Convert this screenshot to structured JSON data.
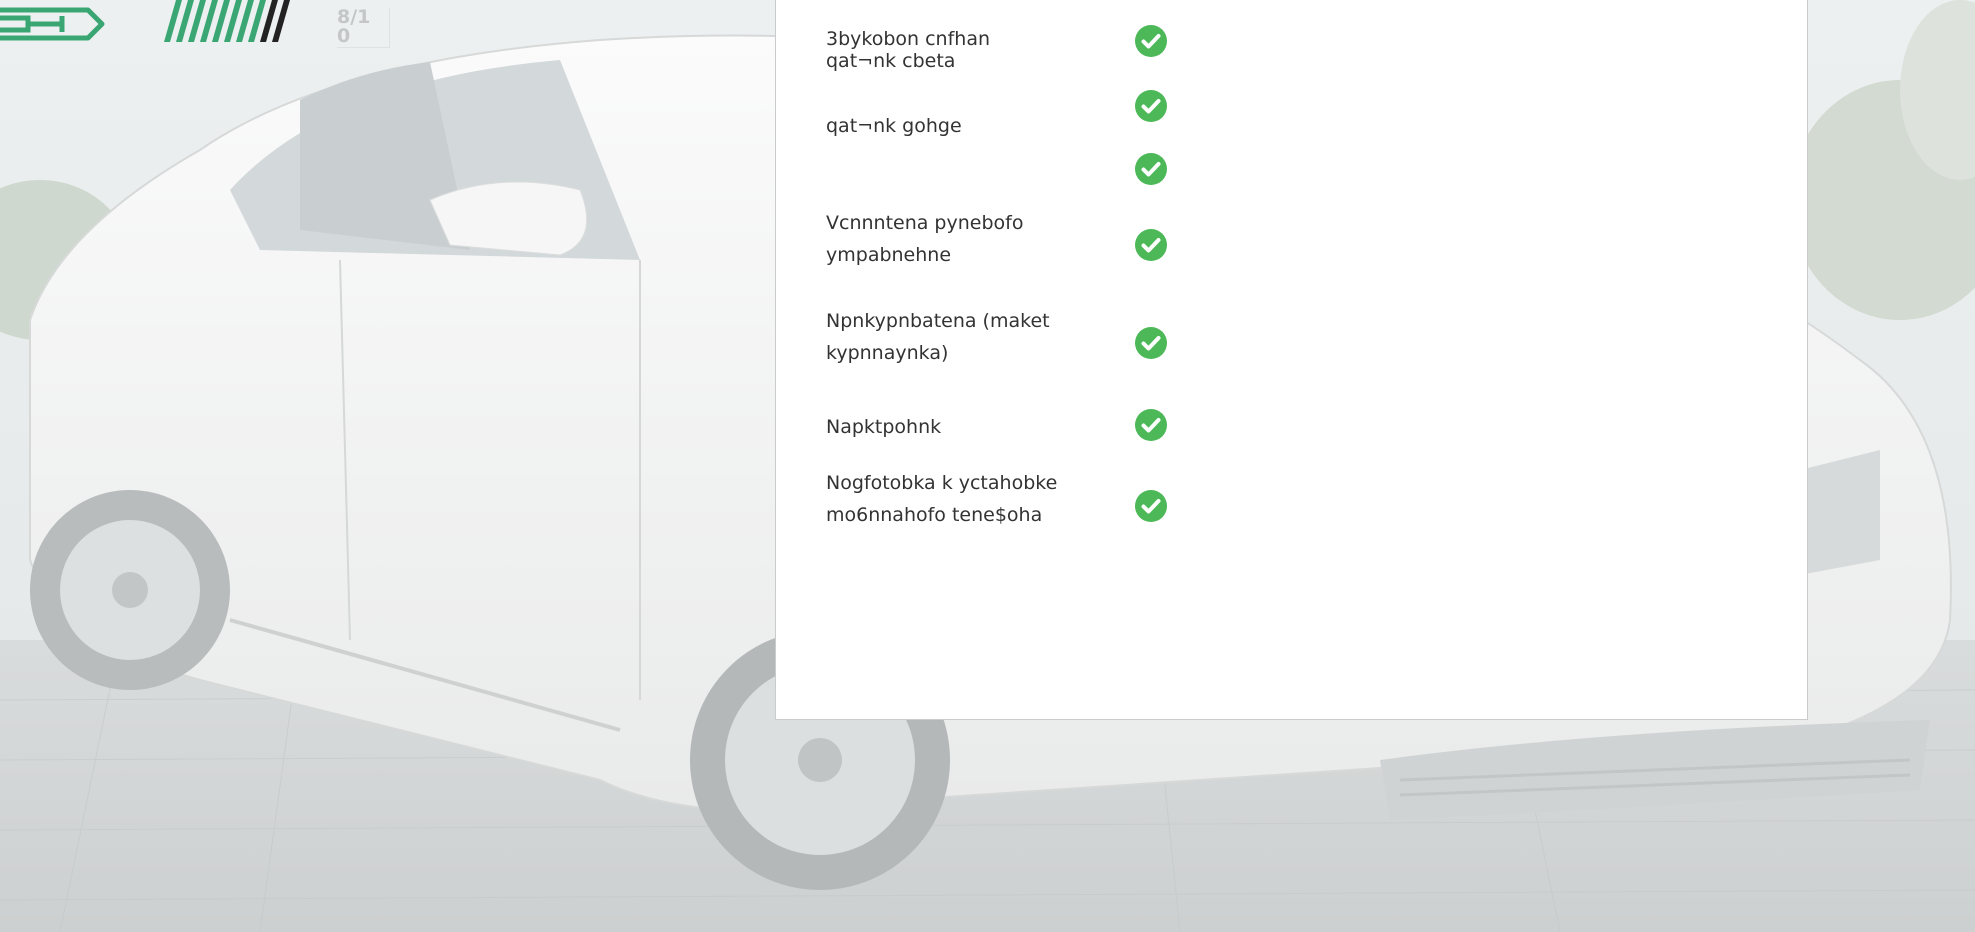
{
  "header": {
    "page_counter": {
      "line1": "8/1",
      "line2": "0"
    },
    "progress": {
      "current": 8,
      "total": 10
    }
  },
  "colors": {
    "accent_green": "#3aa673",
    "check_green": "#4cb858",
    "stripe_dark": "#222222",
    "panel_bg": "#ffffff"
  },
  "checklist": {
    "items": [
      {
        "label": "3bykobon cnfhan\nqat¬nk cbeta",
        "checked": true
      },
      {
        "label": "qat¬nk gohge",
        "checked": true
      },
      {
        "label": "",
        "checked": true
      },
      {
        "label": "Vcnnntena pynebofo\nympabnehne",
        "checked": true
      },
      {
        "label": "Npnkypnbatena (maket\nkypnnaynka)",
        "checked": true
      },
      {
        "label": "Napktpohnk",
        "checked": true
      },
      {
        "label": "Nogfotobka k yctahobke\nmo6nnahofo tene$oha",
        "checked": true
      }
    ]
  }
}
